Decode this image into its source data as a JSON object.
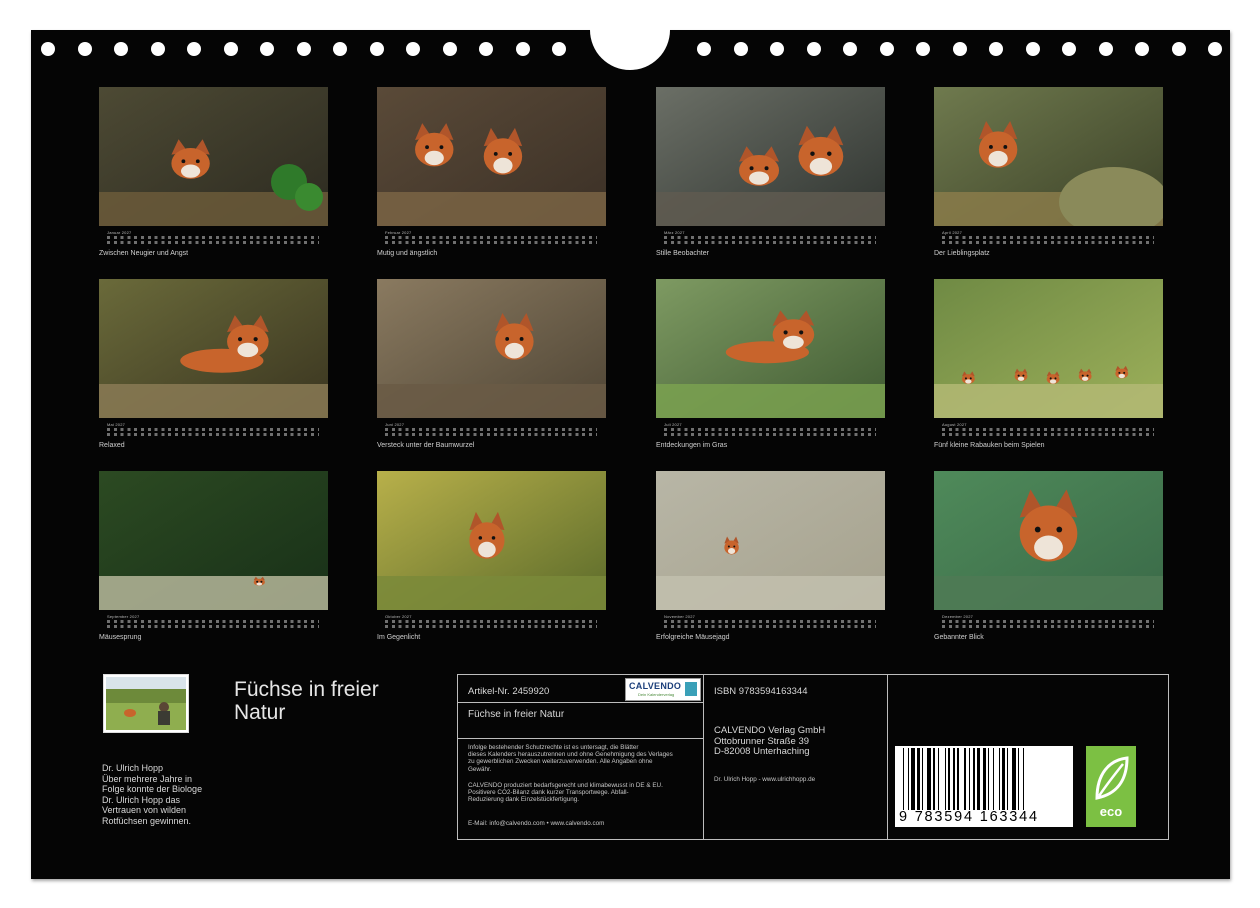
{
  "calendar_title": "Füchse in freier Natur",
  "author": {
    "name": "Dr. Ulrich Hopp",
    "bio_lines": [
      "Über mehrere Jahre in",
      "Folge konnte der Biologe",
      "Dr. Ulrich Hopp das",
      "Vertrauen von wilden",
      "Rotfüchsen gewinnen."
    ]
  },
  "months": [
    {
      "name": "Januar 2027",
      "caption": "Zwischen Neugier und Angst"
    },
    {
      "name": "Februar 2027",
      "caption": "Mutig und ängstlich"
    },
    {
      "name": "März 2027",
      "caption": "Stille Beobachter"
    },
    {
      "name": "April 2027",
      "caption": "Der Lieblingsplatz"
    },
    {
      "name": "Mai 2027",
      "caption": "Relaxed"
    },
    {
      "name": "Juni 2027",
      "caption": "Versteck unter der Baumwurzel"
    },
    {
      "name": "Juli 2027",
      "caption": "Entdeckungen im Gras"
    },
    {
      "name": "August 2027",
      "caption": "Fünf kleine Rabauken beim Spielen"
    },
    {
      "name": "September 2027",
      "caption": "Mäusesprung"
    },
    {
      "name": "Oktober 2027",
      "caption": "Im Gegenlicht"
    },
    {
      "name": "November 2027",
      "caption": "Erfolgreiche Mäusejagd"
    },
    {
      "name": "Dezember 2027",
      "caption": "Gebannter Blick"
    }
  ],
  "info": {
    "article": "Artikel-Nr. 2459920",
    "logo": "CALVENDO",
    "logo_sub": "Dein Kalenderverlag",
    "product_title": "Füchse in freier Natur",
    "legal_lines": [
      "Infolge bestehender Schutzrechte ist es untersagt, die Blätter",
      "dieses Kalenders herauszutrennen und ohne Genehmigung des Verlages",
      "zu gewerblichen Zwecken weiterzuverwenden. Alle Angaben ohne",
      "Gewähr."
    ],
    "eco_lines": [
      "CALVENDO produziert bedarfsgerecht und klimabewusst in DE & EU.",
      "Positivere CO2-Bilanz dank kurzer Transportwege. Abfall-",
      "Reduzierung dank Einzelstückfertigung."
    ],
    "email": "E-Mail: info@calvendo.com • www.calvendo.com",
    "isbn": "ISBN 9783594163344",
    "publisher_lines": [
      "CALVENDO Verlag GmbH",
      "Ottobrunner Straße 39",
      "D-82008 Unterhaching"
    ],
    "author_site": "Dr. Ulrich Hopp - www.ulrichhopp.de",
    "barcode_number": "9  783594  163344",
    "eco_label": "eco"
  },
  "colors": {
    "background": "#050505",
    "eco_green": "#7cc043",
    "fox": "#c8642c"
  }
}
